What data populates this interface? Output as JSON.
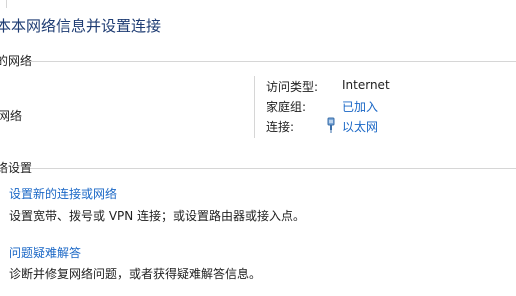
{
  "page": {
    "title": "本本网络信息并设置连接"
  },
  "active_networks": {
    "header": "的网络",
    "network_name": "网络",
    "access_type_label": "访问类型:",
    "access_type_value": "Internet",
    "homegroup_label": "家庭组:",
    "homegroup_value": "已加入",
    "connections_label": "连接:",
    "connections_value": "以太网",
    "connection_icon": "ethernet-plug-icon"
  },
  "change_settings": {
    "header": "络设置",
    "tasks": [
      {
        "link": "设置新的连接或网络",
        "description": "设置宽带、拨号或 VPN 连接；或设置路由器或接入点。"
      },
      {
        "link": "问题疑难解答",
        "description": "诊断并修复网络问题，或者获得疑难解答信息。"
      }
    ]
  },
  "colors": {
    "title": "#1e3c73",
    "link": "#1a67c6",
    "divider": "#d6d6d6"
  }
}
